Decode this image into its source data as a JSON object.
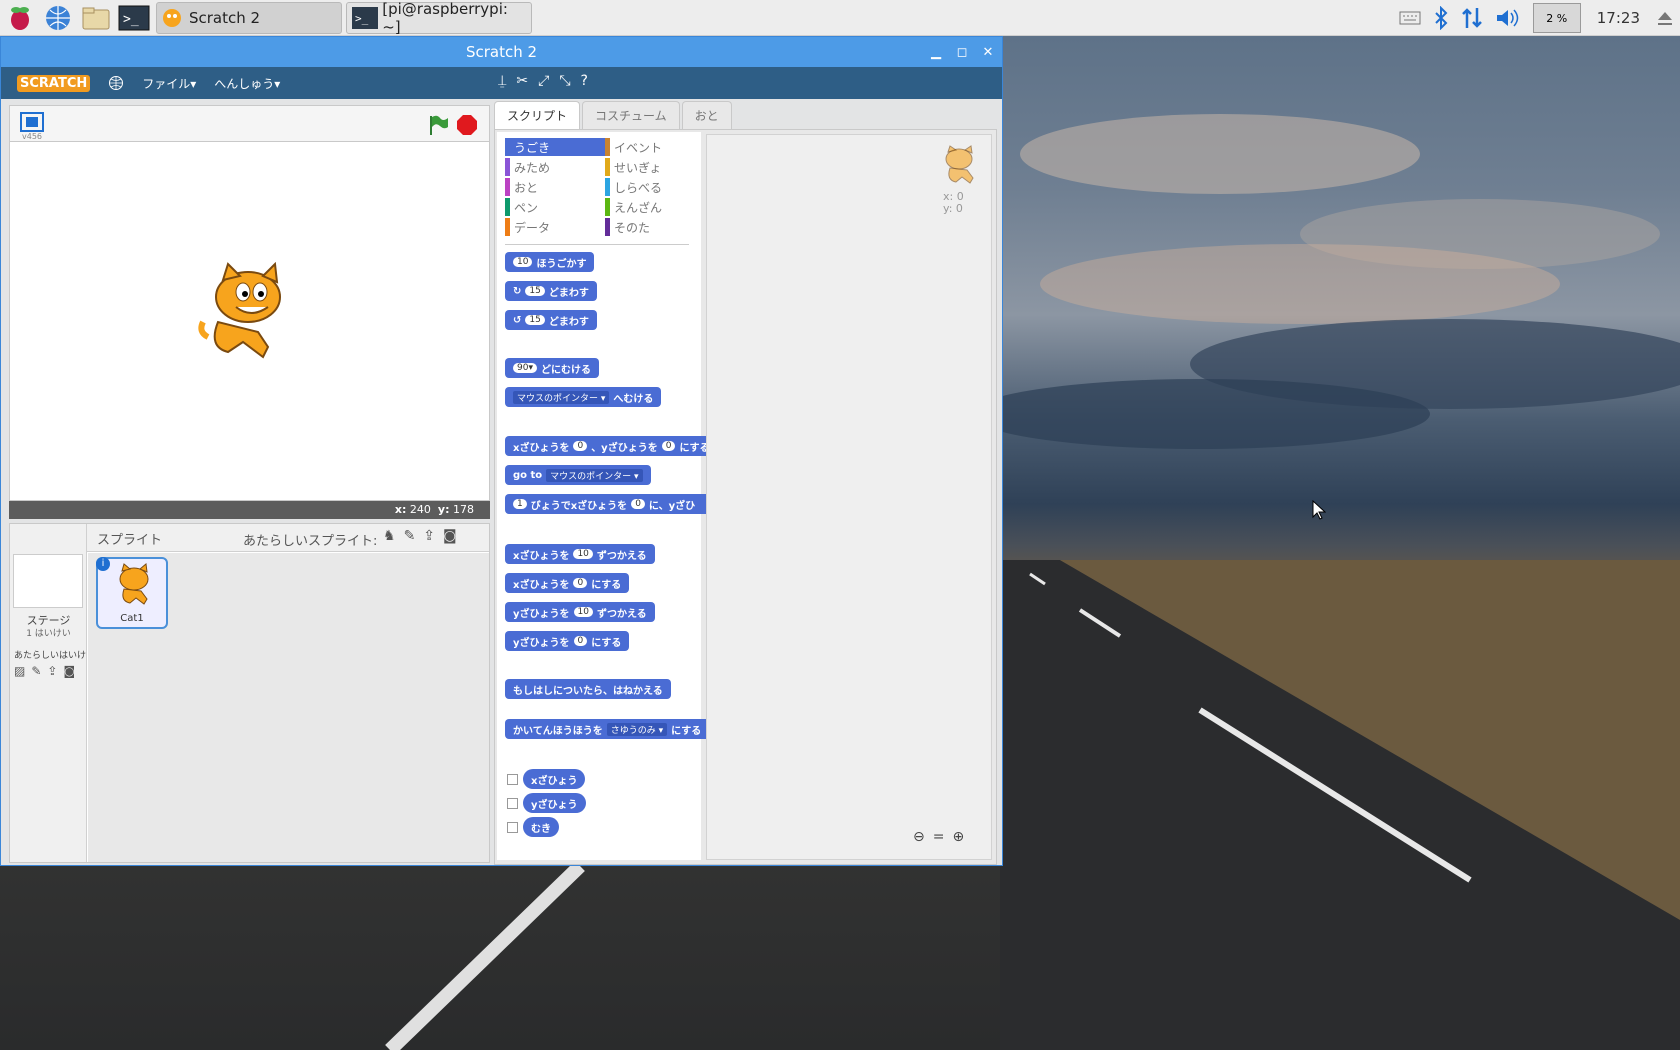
{
  "taskbar": {
    "tasks": [
      {
        "label": "Scratch 2",
        "active": true
      },
      {
        "label": "[pi@raspberrypi: ~]",
        "active": false
      }
    ],
    "cpu": "2 %",
    "clock": "17:23"
  },
  "window": {
    "title": "Scratch 2",
    "menu": {
      "logo": "SCRATCH",
      "file": "ファイル▾",
      "edit": "へんしゅう▾"
    }
  },
  "stage": {
    "version": "v456",
    "coords": {
      "x_label": "x:",
      "x": "240",
      "y_label": "y:",
      "y": "178"
    }
  },
  "sprites": {
    "header": "スプライト",
    "new_sprite": "あたらしいスプライト:",
    "stage_label": "ステージ",
    "stage_sub": "1 はいけい",
    "new_backdrop": "あたらしいはいけ",
    "sprite_name": "Cat1"
  },
  "tabs": [
    "スクリプト",
    "コスチューム",
    "おと"
  ],
  "categories": [
    {
      "label": "うごき",
      "color": "#4a6cd4",
      "active": true
    },
    {
      "label": "イベント",
      "color": "#c88330"
    },
    {
      "label": "みため",
      "color": "#8a55d7"
    },
    {
      "label": "せいぎょ",
      "color": "#e1a91a"
    },
    {
      "label": "おと",
      "color": "#bb42c3"
    },
    {
      "label": "しらべる",
      "color": "#2ca5e2"
    },
    {
      "label": "ペン",
      "color": "#0e9a6c"
    },
    {
      "label": "えんざん",
      "color": "#5cb712"
    },
    {
      "label": "データ",
      "color": "#ee7d16"
    },
    {
      "label": "そのた",
      "color": "#632d99"
    }
  ],
  "blocks": {
    "move_num": "10",
    "move": "ほうごかす",
    "turn_r_num": "15",
    "turn_r": "どまわす",
    "turn_l_num": "15",
    "turn_l": "どまわす",
    "point_num": "90▾",
    "point": "どにむける",
    "toward_dd": "マウスのポインター ▾",
    "toward": "へむける",
    "gotoxy_a": "xざひょうを",
    "gotoxy_x": "0",
    "gotoxy_b": "、yざひょうを",
    "gotoxy_y": "0",
    "gotoxy_c": "にする",
    "goto": "go to",
    "goto_dd": "マウスのポインター ▾",
    "glide_num": "1",
    "glide_a": "びょうでxざひょうを",
    "glide_x": "0",
    "glide_b": "に、yざひ",
    "changex_a": "xざひょうを",
    "changex_num": "10",
    "changex_b": "ずつかえる",
    "setx_a": "xざひょうを",
    "setx_num": "0",
    "setx_b": "にする",
    "changey_a": "yざひょうを",
    "changey_num": "10",
    "changey_b": "ずつかえる",
    "sety_a": "yざひょうを",
    "sety_num": "0",
    "sety_b": "にする",
    "bounce": "もしはしについたら、はねかえる",
    "rotation_a": "かいてんほうほうを",
    "rotation_dd": "さゆうのみ ▾",
    "rotation_b": "にする",
    "rep_x": "xざひょう",
    "rep_y": "yざひょう",
    "rep_dir": "むき"
  },
  "script_area": {
    "x": "x: 0",
    "y": "y: 0"
  }
}
